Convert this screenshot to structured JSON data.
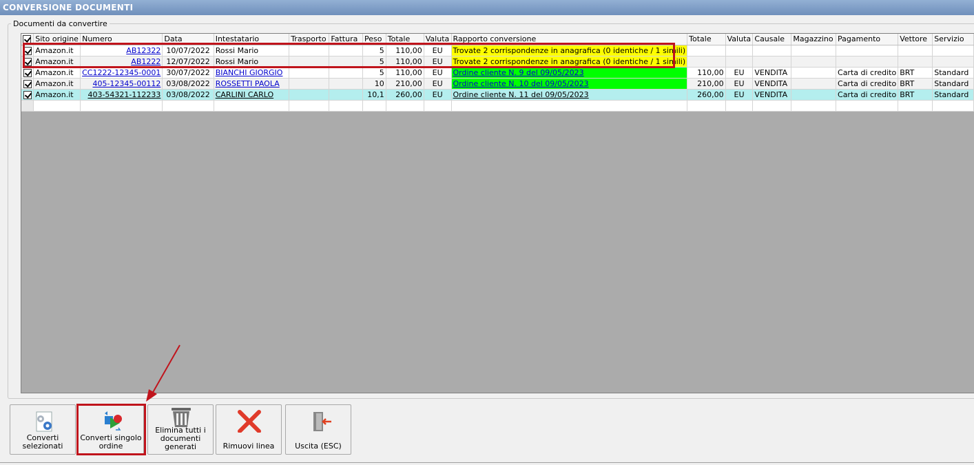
{
  "window": {
    "title": "CONVERSIONE DOCUMENTI"
  },
  "group": {
    "legend": "Documenti da convertire"
  },
  "columns": [
    "Sito origine",
    "Numero",
    "Data",
    "Intestatario",
    "Trasporto",
    "Fattura",
    "Peso",
    "Totale",
    "Valuta",
    "Rapporto conversione",
    "Totale",
    "Valuta",
    "Causale",
    "Magazzino",
    "Pagamento",
    "Vettore",
    "Servizio"
  ],
  "rows": [
    {
      "sito": "Amazon.it",
      "numero": "AB12322",
      "data": "10/07/2022",
      "intestatario": "Rossi Mario",
      "trasporto": "",
      "fattura": "",
      "peso": "5",
      "totale": "110,00",
      "valuta": "EU",
      "rapporto": "Trovate 2 corrispondenze in anagrafica (0 identiche / 1 simili)",
      "totale2": "",
      "valuta2": "",
      "causale": "",
      "magazzino": "",
      "pagamento": "",
      "vettore": "",
      "servizio": ""
    },
    {
      "sito": "Amazon.it",
      "numero": "AB1222",
      "data": "12/07/2022",
      "intestatario": "Rossi Mario",
      "trasporto": "",
      "fattura": "",
      "peso": "5",
      "totale": "110,00",
      "valuta": "EU",
      "rapporto": "Trovate 2 corrispondenze in anagrafica (0 identiche / 1 simili)",
      "totale2": "",
      "valuta2": "",
      "causale": "",
      "magazzino": "",
      "pagamento": "",
      "vettore": "",
      "servizio": ""
    },
    {
      "sito": "Amazon.it",
      "numero": "CC1222-12345-0001",
      "data": "30/07/2022",
      "intestatario": "BIANCHI GIORGIO",
      "trasporto": "",
      "fattura": "",
      "peso": "5",
      "totale": "110,00",
      "valuta": "EU",
      "rapporto": "Ordine cliente N. 9 del 09/05/2023",
      "totale2": "110,00",
      "valuta2": "EU",
      "causale": "VENDITA",
      "magazzino": "",
      "pagamento": "Carta di credito",
      "vettore": "BRT",
      "servizio": "Standard"
    },
    {
      "sito": "Amazon.it",
      "numero": "405-12345-00112",
      "data": "03/08/2022",
      "intestatario": "ROSSETTI PAOLA",
      "trasporto": "",
      "fattura": "",
      "peso": "10",
      "totale": "210,00",
      "valuta": "EU",
      "rapporto": "Ordine cliente N. 10 del 09/05/2023",
      "totale2": "210,00",
      "valuta2": "EU",
      "causale": "VENDITA",
      "magazzino": "",
      "pagamento": "Carta di credito",
      "vettore": "BRT",
      "servizio": "Standard"
    },
    {
      "sito": "Amazon.it",
      "numero": "403-54321-112233",
      "data": "03/08/2022",
      "intestatario": "CARLINI CARLO",
      "trasporto": "",
      "fattura": "",
      "peso": "10,1",
      "totale": "260,00",
      "valuta": "EU",
      "rapporto": "Ordine cliente N. 11 del 09/05/2023",
      "totale2": "260,00",
      "valuta2": "EU",
      "causale": "VENDITA",
      "magazzino": "",
      "pagamento": "Carta di credito",
      "vettore": "BRT",
      "servizio": "Standard"
    }
  ],
  "buttons": {
    "converti_selezionati": "Converti selezionati",
    "converti_singolo": "Converti singolo ordine",
    "elimina_tutti": "Elimina tutti i documenti generati",
    "rimuovi_linea": "Rimuovi linea",
    "uscita": "Uscita (ESC)"
  },
  "colors": {
    "warning_highlight": "#ffff00",
    "success_highlight": "#00ff00",
    "selected_row": "#b4eeee",
    "annotation_red": "#c0141c",
    "titlebar": "#7f9dc6"
  }
}
